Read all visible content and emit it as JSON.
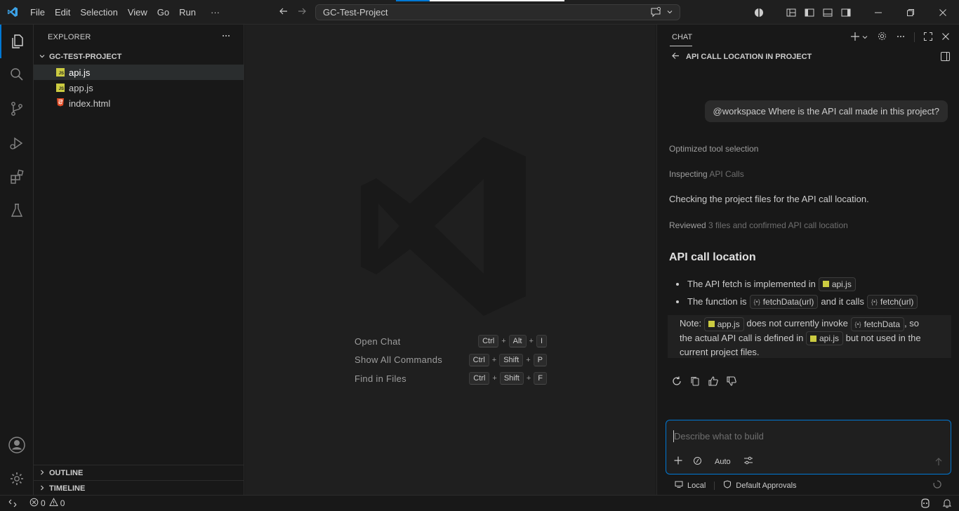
{
  "titlebar": {
    "menu": [
      "File",
      "Edit",
      "Selection",
      "View",
      "Go",
      "Run",
      "···"
    ],
    "command_center": "GC-Test-Project"
  },
  "explorer": {
    "header": "EXPLORER",
    "project": "GC-TEST-PROJECT",
    "files": [
      {
        "name": "api.js",
        "icon": "js-file-icon",
        "selected": true
      },
      {
        "name": "app.js",
        "icon": "js-file-icon",
        "selected": false
      },
      {
        "name": "index.html",
        "icon": "html-file-icon",
        "selected": false
      }
    ],
    "outline": "OUTLINE",
    "timeline": "TIMELINE"
  },
  "editor": {
    "shortcuts": [
      {
        "label": "Open Chat",
        "keys": [
          "Ctrl",
          "Alt",
          "I"
        ]
      },
      {
        "label": "Show All Commands",
        "keys": [
          "Ctrl",
          "Shift",
          "P"
        ]
      },
      {
        "label": "Find in Files",
        "keys": [
          "Ctrl",
          "Shift",
          "F"
        ]
      }
    ]
  },
  "chat": {
    "tab_title": "CHAT",
    "breadcrumb": "API CALL LOCATION IN PROJECT",
    "user_message": "@workspace Where is the API call made in this project?",
    "progress": {
      "optimized": "Optimized tool selection",
      "inspecting_prefix": "Inspecting",
      "inspecting_target": "API Calls",
      "checking": "Checking the project files for the API call location.",
      "reviewed_prefix": "Reviewed",
      "reviewed_detail": "3 files and confirmed API call location"
    },
    "heading": "API call location",
    "bullets": {
      "b1_text": "The API fetch is implemented in",
      "b1_chip": "api.js",
      "b2_text": "The function is",
      "b2_chip": "fetchData(url)",
      "b2_mid": "and it calls",
      "b2_chip2": "fetch(url)"
    },
    "note": {
      "prefix": "Note:",
      "chip1": "app.js",
      "mid1": "does not currently invoke",
      "chip2": "fetchData",
      "mid2": ", so",
      "line2_prefix": "the actual API call is defined in",
      "chip3": "api.js",
      "line2_suffix": "but not used in the",
      "line3": "current project files."
    },
    "input": {
      "placeholder": "Describe what to build",
      "mode": "Auto"
    },
    "footer": {
      "location": "Local",
      "approvals": "Default Approvals"
    }
  },
  "statusbar": {
    "errors": "0",
    "warnings": "0"
  },
  "colors": {
    "accent": "#0078d4",
    "background": "#181818",
    "editor_bg": "#1f1f1f",
    "js_icon": "#cbcb41",
    "html_icon": "#e44d26"
  }
}
